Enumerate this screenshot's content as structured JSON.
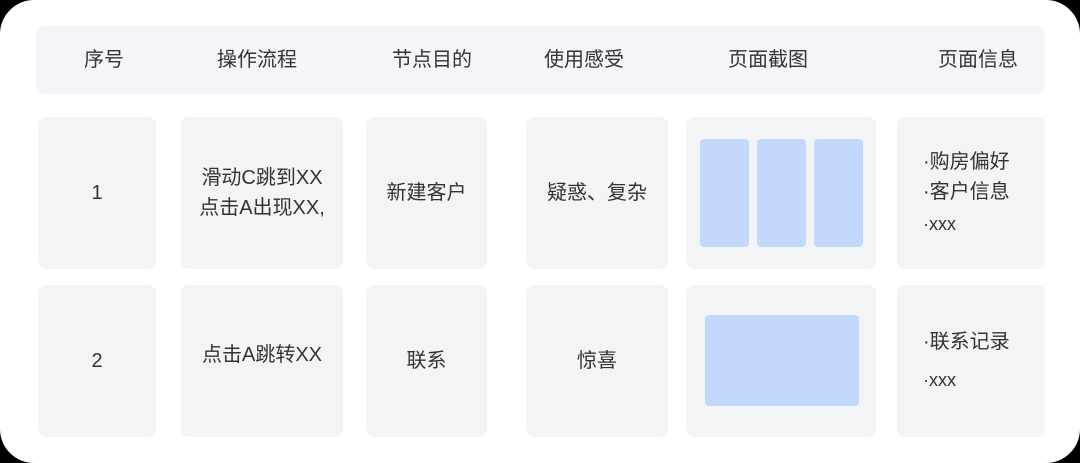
{
  "header": [
    "序号",
    "操作流程",
    "节点目的",
    "使用感受",
    "页面截图",
    "页面信息"
  ],
  "rows": [
    {
      "index": "1",
      "flow": [
        "滑动C跳到XX",
        "点击A出现XX,"
      ],
      "purpose": "新建客户",
      "feeling": "疑惑、复杂",
      "screenshot": "three-vertical-panels",
      "info": [
        "·购房偏好",
        "·客户信息",
        "·xxx"
      ]
    },
    {
      "index": "2",
      "flow": [
        "点击A跳转XX"
      ],
      "purpose": "联系",
      "feeling": "惊喜",
      "screenshot": "single-wide-panel",
      "info": [
        "·联系记录",
        "·xxx"
      ]
    }
  ],
  "colors": {
    "header_bg": "#f3f5f8",
    "cell_bg": "#f3f4f6",
    "screenshot_placeholder": "#c2d9fb"
  }
}
